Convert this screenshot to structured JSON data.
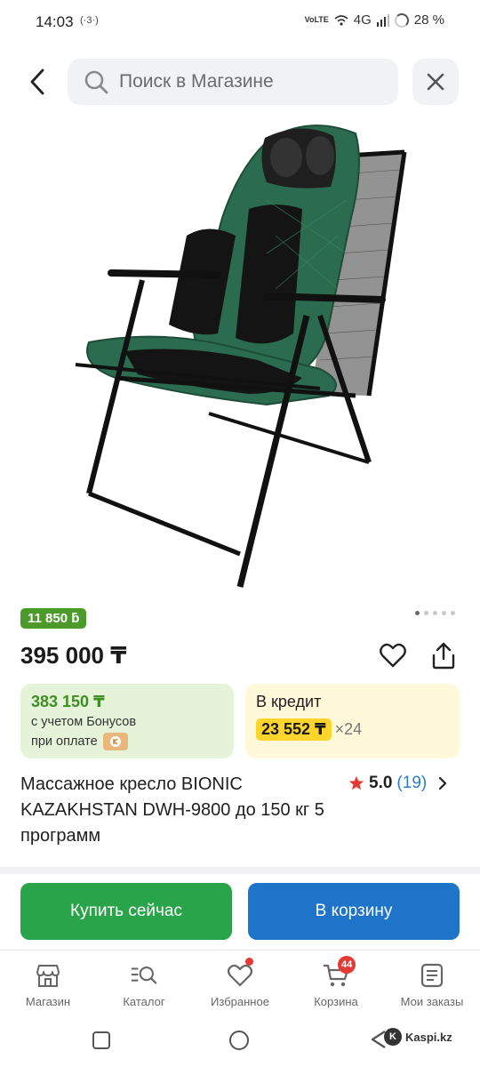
{
  "status_bar": {
    "time": "14:03",
    "small_icon": "(·3·)",
    "network_tiny": "VoLTE",
    "network": "4G",
    "battery": "28 %"
  },
  "search": {
    "placeholder": "Поиск в Магазине"
  },
  "product": {
    "bonus_badge": "11 850 ƃ",
    "price": "395 000 ₸",
    "bonus_card": {
      "amount": "383 150 ₸",
      "line1": "с учетом Бонусов",
      "line2": "при оплате"
    },
    "credit_card": {
      "title": "В кредит",
      "monthly": "23 552 ₸",
      "times": "×24"
    },
    "title": "Массажное кресло BIONIC KAZAKHSTAN DWH-9800 до 150 кг 5 программ",
    "rating": {
      "score": "5.0",
      "count": "(19)"
    },
    "gallery_dots": 5,
    "gallery_active_index": 0
  },
  "actions": {
    "buy_label": "Купить сейчас",
    "cart_label": "В корзину"
  },
  "tabs": [
    {
      "label": "Магазин",
      "icon": "store-icon"
    },
    {
      "label": "Каталог",
      "icon": "catalog-search-icon"
    },
    {
      "label": "Избранное",
      "icon": "heart-icon"
    },
    {
      "label": "Корзина",
      "icon": "cart-icon",
      "badge": "44"
    },
    {
      "label": "Мои заказы",
      "icon": "orders-icon"
    }
  ],
  "watermark": "Kaspi.kz",
  "colors": {
    "green": "#2aa44a",
    "blue": "#1e74c8",
    "bonus_green": "#4c9a2a",
    "credit_yellow": "#ffd52b",
    "rating_star": "#e53935",
    "rating_count": "#2a7dd1"
  }
}
